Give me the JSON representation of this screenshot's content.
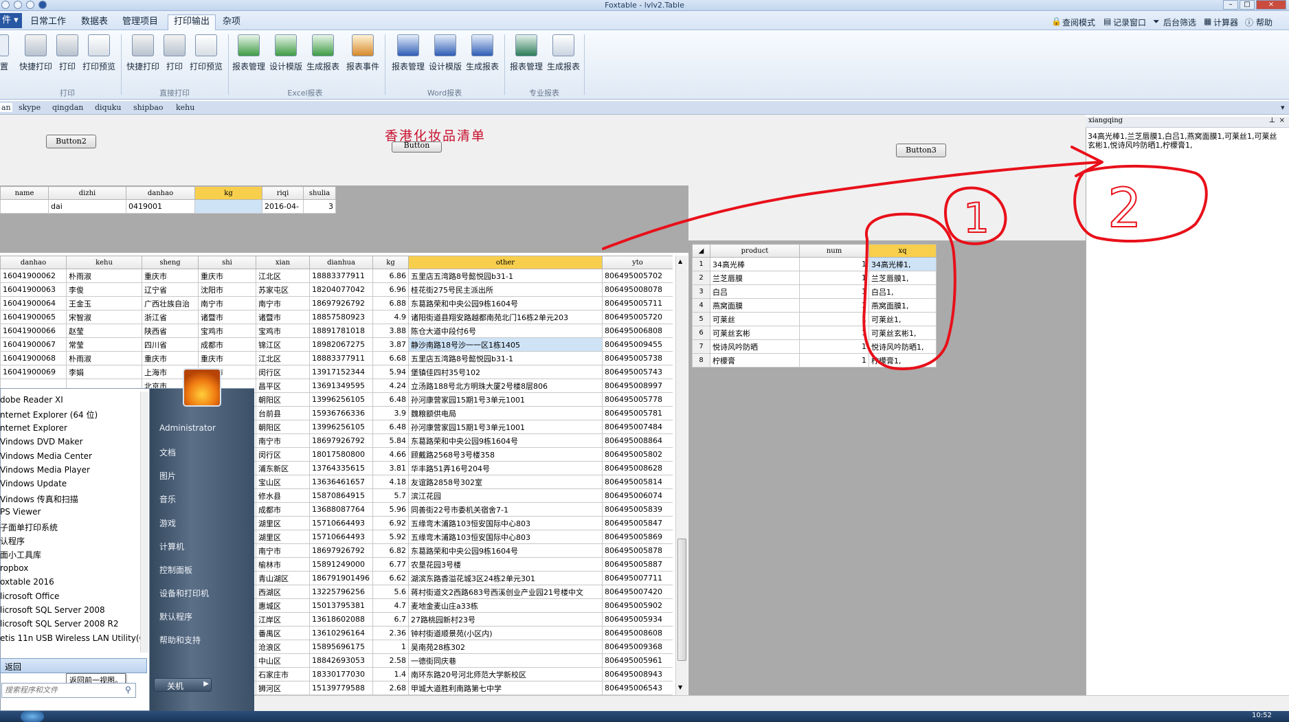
{
  "window": {
    "title": "Foxtable - lvlv2.Table"
  },
  "menu": {
    "file_label": "件 ▾",
    "tabs": [
      "日常工作",
      "数据表",
      "管理项目",
      "打印输出",
      "杂项"
    ],
    "right_links": [
      "查阅模式",
      "记录窗口",
      "后台筛选",
      "计算器",
      "帮助"
    ]
  },
  "ribbon": {
    "left_cut_label": "置",
    "buttons": [
      "快捷打印",
      "打印",
      "打印预览",
      "快捷打印",
      "打印",
      "打印预览",
      "报表管理",
      "设计模版",
      "生成报表",
      "报表事件",
      "报表管理",
      "设计模版",
      "生成报表",
      "报表管理",
      "生成报表"
    ],
    "groups": [
      "打印",
      "直接打印",
      "Excel报表",
      "Word报表",
      "专业报表"
    ]
  },
  "doc_tabs": [
    "an",
    "skype",
    "qingdan",
    "diquku",
    "shipbao",
    "kehu"
  ],
  "form": {
    "title": "香港化妆品清单",
    "button2": "Button2",
    "button_hidden": "Button",
    "button3": "Button3"
  },
  "top_grid": {
    "headers": [
      "name",
      "dizhi",
      "danhao",
      "kg",
      "riqi",
      "shulia"
    ],
    "row": [
      "",
      "dai",
      "0419001",
      "",
      "2016-04-",
      "3"
    ]
  },
  "main_grid": {
    "headers": [
      "danhao",
      "kehu",
      "sheng",
      "shi",
      "xian",
      "dianhua",
      "kg",
      "other",
      "yto"
    ],
    "rows": [
      [
        "16041900062",
        "朴雨淑",
        "重庆市",
        "重庆市",
        "江北区",
        "18883377911",
        "6.86",
        "五里店五湾路8号懿悦园b31-1",
        "806495005702"
      ],
      [
        "16041900063",
        "李俊",
        "辽宁省",
        "沈阳市",
        "苏家屯区",
        "18204077042",
        "6.96",
        "桂花街275号民主派出所",
        "806495008078"
      ],
      [
        "16041900064",
        "王金玉",
        "广西壮族自治",
        "南宁市",
        "南宁市",
        "18697926792",
        "6.88",
        "东葛路荣和中央公园9栋1604号",
        "806495005711"
      ],
      [
        "16041900065",
        "宋智淑",
        "浙江省",
        "诸暨市",
        "诸暨市",
        "18857580923",
        "4.9",
        "诸阳街道县翔安路越都南苑北门16栋2单元203",
        "806495005720"
      ],
      [
        "16041900066",
        "赵莹",
        "陕西省",
        "宝鸡市",
        "宝鸡市",
        "18891781018",
        "3.88",
        "陈仓大道中段付6号",
        "806495006808"
      ],
      [
        "16041900067",
        "常莹",
        "四川省",
        "成都市",
        "锦江区",
        "18982067275",
        "3.87",
        "静沙南路18号沙一一区1栋1405",
        "806495009455"
      ],
      [
        "16041900068",
        "朴雨淑",
        "重庆市",
        "重庆市",
        "江北区",
        "18883377911",
        "6.68",
        "五里店五湾路8号懿悦园b31-1",
        "806495005738"
      ],
      [
        "16041900069",
        "李娟",
        "上海市",
        "上海市",
        "闵行区",
        "13917152344",
        "5.94",
        "堡镇佳四村35号102",
        "806495005743"
      ],
      [
        "",
        "",
        "北京市",
        "",
        "昌平区",
        "13691349595",
        "4.24",
        "立汤路188号北方明珠大厦2号楼8层806",
        "806495008997"
      ],
      [
        "",
        "",
        "",
        "",
        "朝阳区",
        "13996256105",
        "6.48",
        "孙河康营家园15期1号3单元1001",
        "806495005778"
      ],
      [
        "",
        "",
        "",
        "",
        "台前县",
        "15936766336",
        "3.9",
        "魏粮额供电局",
        "806495005781"
      ],
      [
        "",
        "",
        "",
        "",
        "朝阳区",
        "13996256105",
        "6.48",
        "孙河康营家园15期1号3单元1001",
        "806495007484"
      ],
      [
        "",
        "",
        "",
        "",
        "南宁市",
        "18697926792",
        "5.84",
        "东葛路荣和中央公园9栋1604号",
        "806495008864"
      ],
      [
        "",
        "",
        "",
        "",
        "闵行区",
        "18017580800",
        "4.66",
        "顾戴路2568号3号楼358",
        "806495005802"
      ],
      [
        "",
        "",
        "",
        "",
        "浦东新区",
        "13764335615",
        "3.81",
        "华丰路51弄16号204号",
        "806495008628"
      ],
      [
        "",
        "",
        "",
        "",
        "宝山区",
        "13636461657",
        "4.18",
        "友谊路2858号302室",
        "806495005814"
      ],
      [
        "",
        "",
        "",
        "",
        "修水县",
        "15870864915",
        "5.7",
        "滨江花园",
        "806495006074"
      ],
      [
        "",
        "",
        "",
        "",
        "成都市",
        "13688087764",
        "5.96",
        "同善街22号市委机关宿舍7-1",
        "806495005839"
      ],
      [
        "",
        "",
        "",
        "",
        "湖里区",
        "15710664493",
        "6.92",
        "五缘弯木浦路103恒安国际中心803",
        "806495005847"
      ],
      [
        "",
        "",
        "",
        "",
        "湖里区",
        "15710664493",
        "5.92",
        "五缘弯木浦路103恒安国际中心803",
        "806495005869"
      ],
      [
        "",
        "",
        "",
        "",
        "南宁市",
        "18697926792",
        "6.82",
        "东葛路荣和中央公园9栋1604号",
        "806495005878"
      ],
      [
        "",
        "",
        "",
        "",
        "榆林市",
        "15891249000",
        "6.77",
        "农垦花园3号楼",
        "806495005887"
      ],
      [
        "",
        "",
        "",
        "",
        "青山湖区",
        "186791901496",
        "6.62",
        "湖滨东路香溢花城3区24栋2单元301",
        "806495007711"
      ],
      [
        "",
        "",
        "",
        "",
        "西湖区",
        "13225796256",
        "5.6",
        "蒋村街道文2西路683号西溪创业产业园21号楼中文",
        "806495007420"
      ],
      [
        "",
        "",
        "",
        "",
        "惠城区",
        "15013795381",
        "4.7",
        "麦地金麦山庄a33栋",
        "806495005902"
      ],
      [
        "",
        "",
        "",
        "",
        "江岸区",
        "13618602088",
        "6.7",
        "27路桃园新村23号",
        "806495005934"
      ],
      [
        "",
        "",
        "",
        "",
        "番禺区",
        "13610296164",
        "2.36",
        "钟村街道顺景苑(小区内)",
        "806495008608"
      ],
      [
        "",
        "",
        "",
        "",
        "沧浪区",
        "15895696175",
        "1",
        "吴南苑28栋302",
        "806495009368"
      ],
      [
        "",
        "",
        "",
        "",
        "中山区",
        "18842693053",
        "2.58",
        "一德街同庆巷",
        "806495005961"
      ],
      [
        "",
        "",
        "",
        "",
        "石家庄市",
        "18330177030",
        "1.4",
        "南环东路20号河北师范大学新校区",
        "806495008943"
      ],
      [
        "",
        "",
        "",
        "",
        "狮河区",
        "15139779588",
        "2.68",
        "甲城大道胜利南路第七中学",
        "806495006543"
      ]
    ]
  },
  "product_grid": {
    "headers": [
      "product",
      "num",
      "xq"
    ],
    "rows": [
      [
        "1",
        "34高光棒",
        "1",
        "34高光棒1,"
      ],
      [
        "2",
        "兰芝唇膜",
        "1",
        "兰芝唇膜1,"
      ],
      [
        "3",
        "白吕",
        "1",
        "白吕1,"
      ],
      [
        "4",
        "燕窝面膜",
        "1",
        "燕窝面膜1,"
      ],
      [
        "5",
        "可莱丝",
        "1",
        "可莱丝1,"
      ],
      [
        "6",
        "可莱丝玄彬",
        "1",
        "可莱丝玄彬1,"
      ],
      [
        "7",
        "悦诗风吟防晒",
        "1",
        "悦诗风吟防晒1,"
      ],
      [
        "8",
        "柠檬膏",
        "1",
        "柠檬膏1,"
      ]
    ]
  },
  "detail": {
    "title": "xiangqing",
    "text": "34高光棒1,兰芝唇膜1,白吕1,燕窝面膜1,可莱丝1,可莱丝玄彬1,悦诗风吟防晒1,柠檬膏1,"
  },
  "start_menu": {
    "programs": [
      "dobe Reader XI",
      "nternet Explorer (64 位)",
      "nternet Explorer",
      "Vindows DVD Maker",
      "Vindows Media Center",
      "Vindows Media Player",
      "Vindows Update",
      "Vindows 传真和扫描",
      "PS Viewer",
      "子面单打印系统",
      "认程序",
      "面小工具库",
      "ropbox",
      "oxtable 2016",
      "licrosoft Office",
      "licrosoft SQL Server 2008",
      "licrosoft SQL Server 2008 R2",
      "etis 11n USB Wireless LAN Utility(C"
    ],
    "back": "返回",
    "tooltip": "返回前一视图。",
    "search_placeholder": "搜索程序和文件",
    "right_items": [
      "Administrator",
      "文档",
      "图片",
      "音乐",
      "游戏",
      "计算机",
      "控制面板",
      "设备和打印机",
      "默认程序",
      "帮助和支持"
    ],
    "shutdown": "关机"
  },
  "annotations": {
    "label1": "1",
    "label2": "2",
    "color": "#e8101a"
  },
  "taskbar": {
    "clock": "10:52"
  }
}
